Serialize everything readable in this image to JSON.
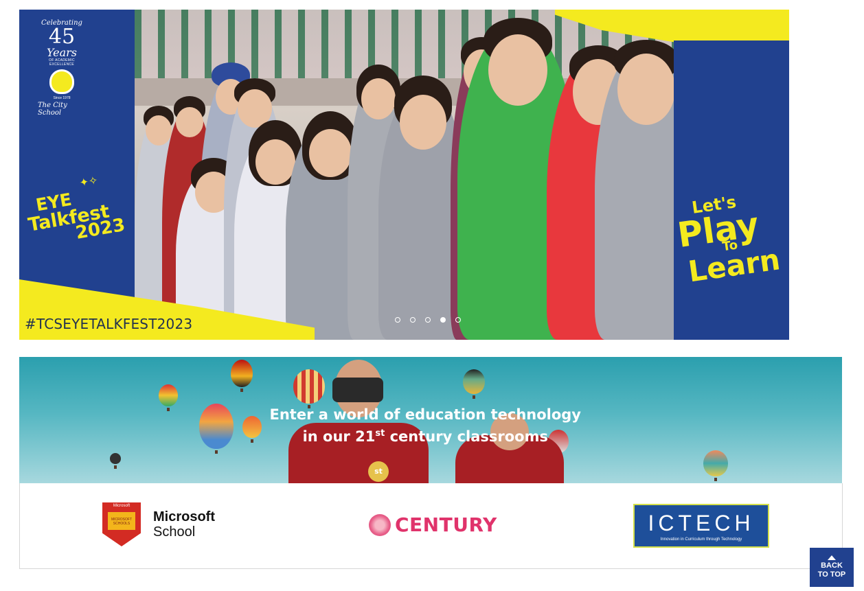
{
  "hero": {
    "logo": {
      "celebrating": "Celebrating",
      "number": "45",
      "years": "Years",
      "excellence": "OF ACADEMIC EXCELLENCE",
      "since": "Since 1978",
      "school_name": "The City School"
    },
    "talkfest": {
      "line1": "EYE",
      "line2": "Talkfest",
      "line3": "2023"
    },
    "hashtag": "#TCSEYETALKFEST2023",
    "play": {
      "lets": "Let's",
      "play": "Play",
      "to": "To",
      "learn": "Learn"
    },
    "carousel": {
      "total_slides": 5,
      "active_slide": 4
    },
    "colors": {
      "panel_blue": "#21418f",
      "accent_yellow": "#f4ea1f"
    }
  },
  "tech_banner": {
    "headline_line1": "Enter a world of education technology",
    "headline_line2_pre": "in our 21",
    "headline_line2_sup": "st",
    "headline_line2_post": " century classrooms",
    "badge_text": "st"
  },
  "partners": {
    "microsoft": {
      "badge_text": "Microsoft",
      "shield_text": "MICROSOFT SCHOOLS",
      "line1": "Microsoft",
      "line2": "School"
    },
    "century": {
      "name": "CENTURY"
    },
    "ictech": {
      "name": "ICTECH",
      "tagline": "Innovation in Curriculum through Technology"
    }
  },
  "back_to_top": {
    "line1": "BACK",
    "line2": "TO TOP"
  }
}
